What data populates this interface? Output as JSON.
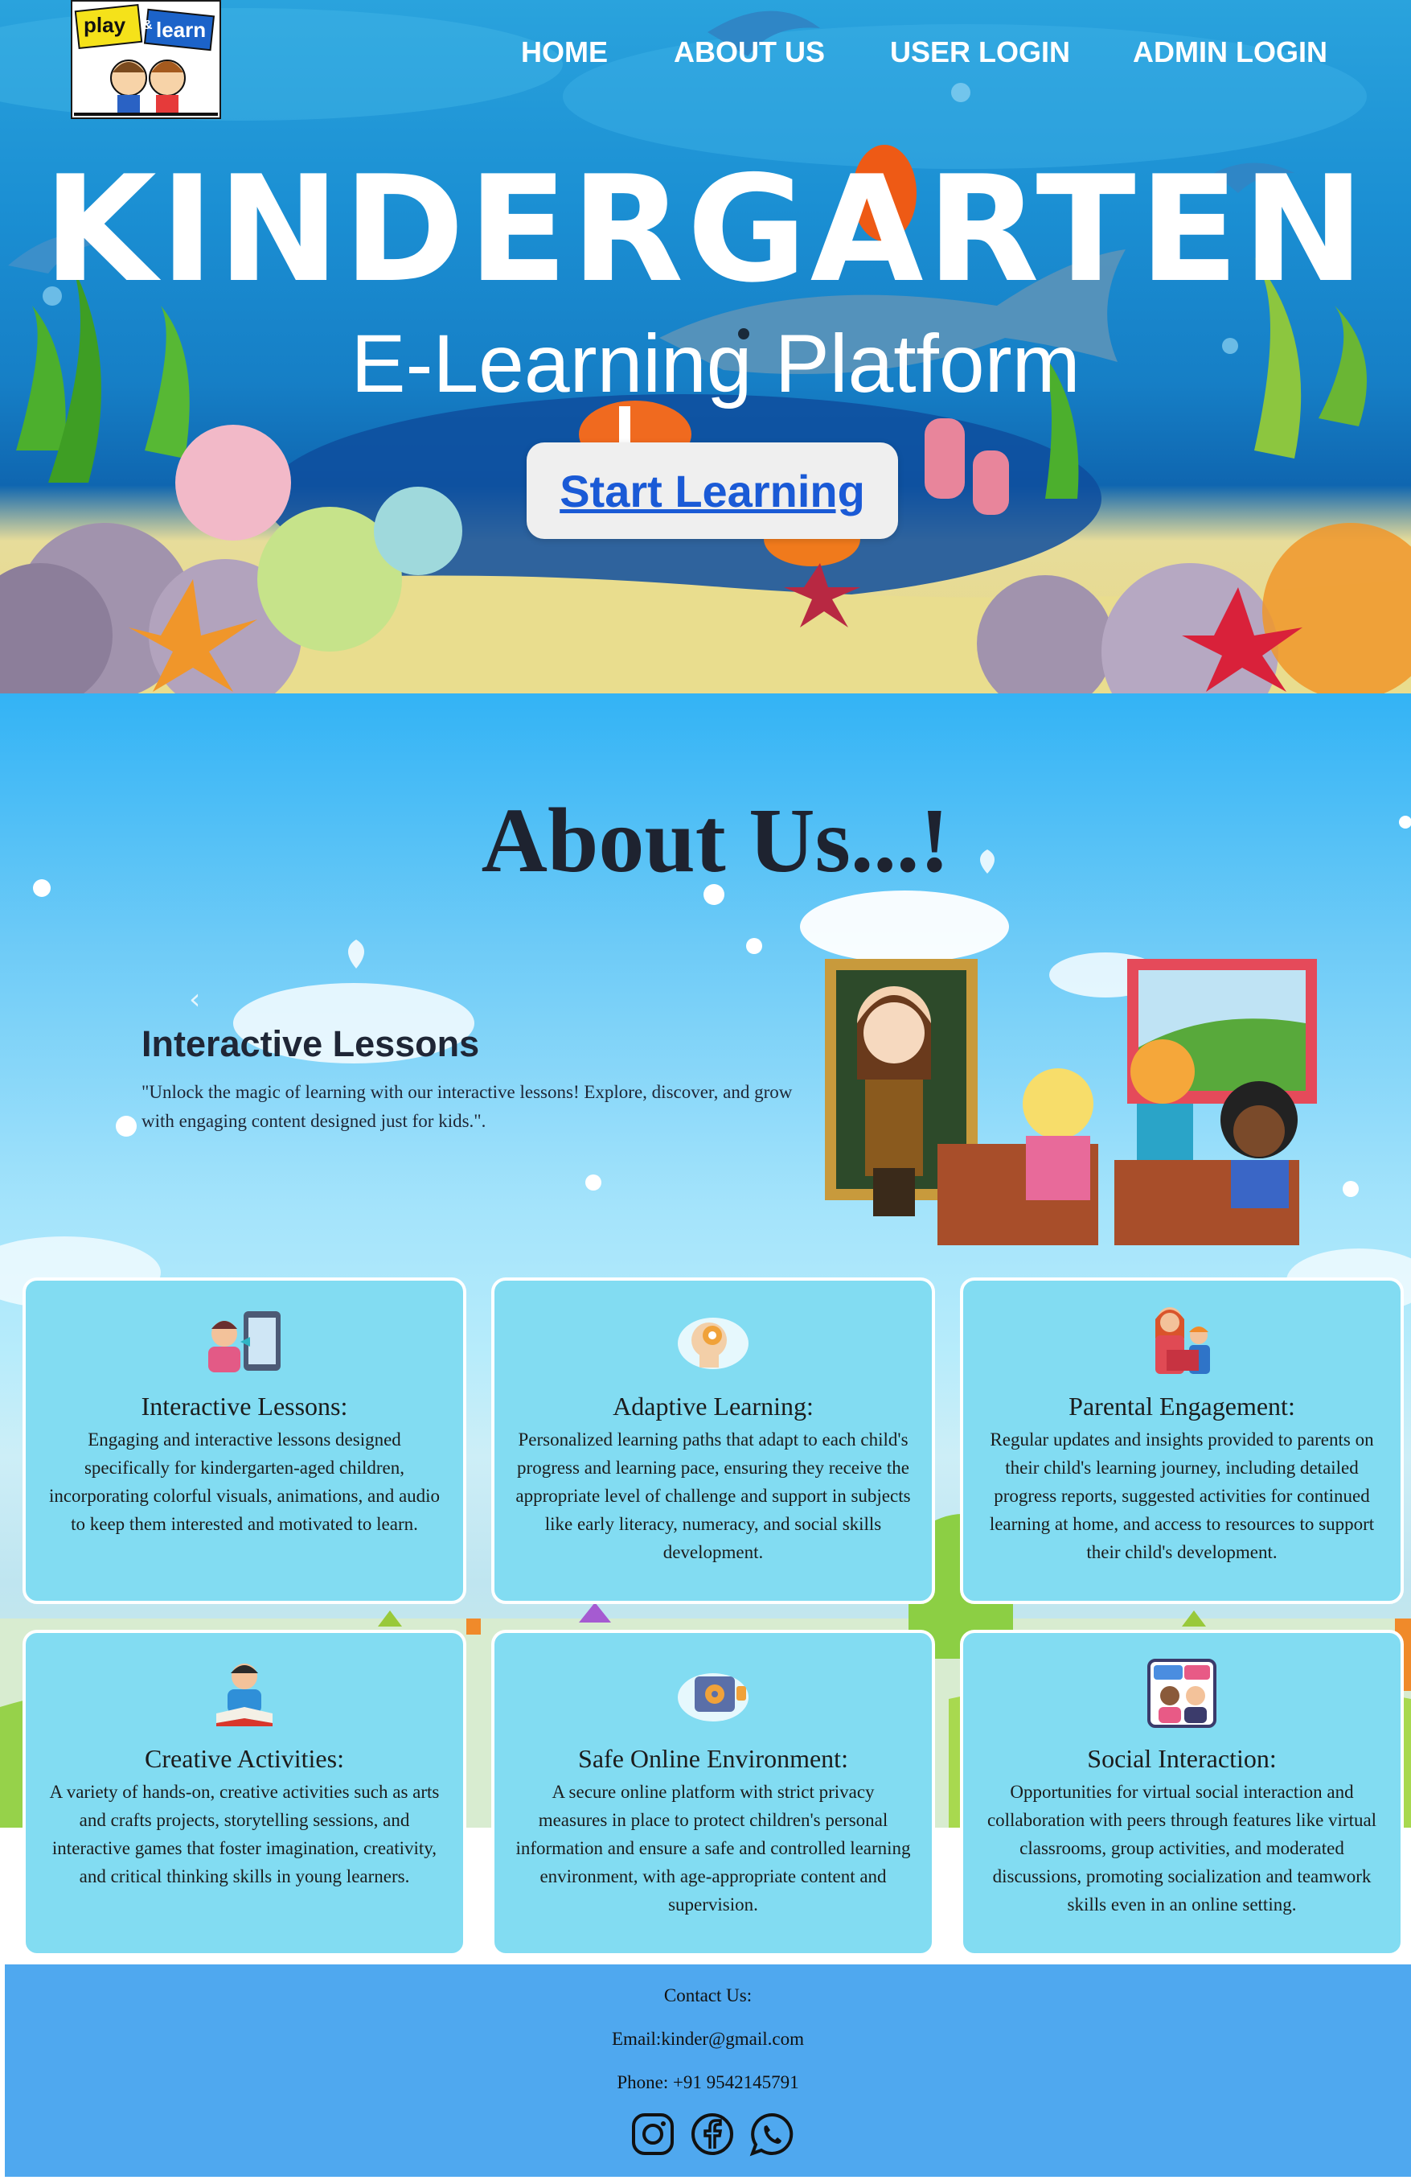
{
  "nav": {
    "home": "HOME",
    "about": "ABOUT US",
    "user_login": "USER LOGIN",
    "admin_login": "ADMIN LOGIN"
  },
  "logo": {
    "word1": "play",
    "amp": "&",
    "word2": "learn"
  },
  "hero": {
    "title": "KINDERGARTEN",
    "subtitle": "E-Learning Platform",
    "cta": "Start Learning"
  },
  "about": {
    "title": "About Us...!",
    "carousel": {
      "title": "Interactive Lessons",
      "text": "\"Unlock the magic of learning with our interactive lessons! Explore, discover, and grow with engaging content designed just for kids.\"."
    }
  },
  "features": [
    {
      "title": "Interactive Lessons:",
      "icon": "tablet-lesson-icon",
      "text": "Engaging and interactive lessons designed specifically for kindergarten-aged children, incorporating colorful visuals, animations, and audio to keep them interested and motivated to learn."
    },
    {
      "title": "Adaptive Learning:",
      "icon": "brain-gear-icon",
      "text": "Personalized learning paths that adapt to each child's progress and learning pace, ensuring they receive the appropriate level of challenge and support in subjects like early literacy, numeracy, and social skills development."
    },
    {
      "title": "Parental Engagement:",
      "icon": "parent-child-reading-icon",
      "text": "Regular updates and insights provided to parents on their child's learning journey, including detailed progress reports, suggested activities for continued learning at home, and access to resources to support their child's development."
    },
    {
      "title": "Creative Activities:",
      "icon": "child-reading-icon",
      "text": "A variety of hands-on, creative activities such as arts and crafts projects, storytelling sessions, and interactive games that foster imagination, creativity, and critical thinking skills in young learners."
    },
    {
      "title": "Safe Online Environment:",
      "icon": "secure-vault-icon",
      "text": "A secure online platform with strict privacy measures in place to protect children's personal information and ensure a safe and controlled learning environment, with age-appropriate content and supervision."
    },
    {
      "title": "Social Interaction:",
      "icon": "chat-people-icon",
      "text": "Opportunities for virtual social interaction and collaboration with peers through features like virtual classrooms, group activities, and moderated discussions, promoting socialization and teamwork skills even in an online setting."
    }
  ],
  "footer": {
    "contact_label": "Contact Us:",
    "email": "Email:kinder@gmail.com",
    "phone": "Phone: +91 9542145791",
    "social_icons": [
      "instagram-icon",
      "facebook-icon",
      "whatsapp-icon"
    ]
  },
  "colors": {
    "card_bg": "#82dcf2",
    "footer_bg": "#4fa8ef",
    "cta_text": "#1a5ad6"
  }
}
